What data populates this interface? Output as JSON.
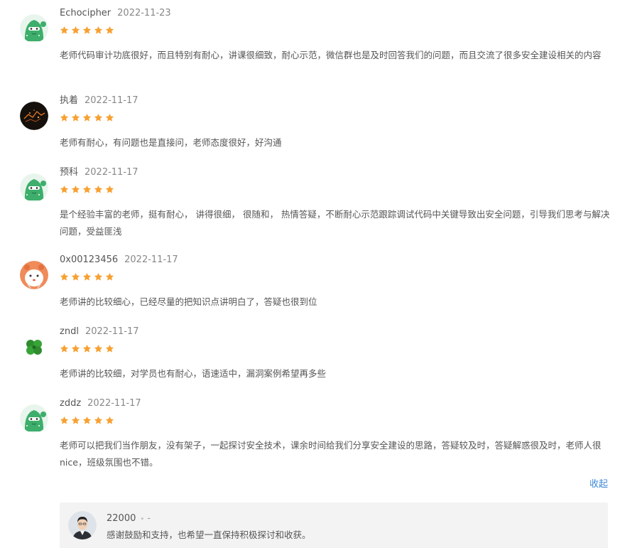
{
  "reviews": [
    {
      "user": "Echocipher",
      "date": "2022-11-23",
      "avatar": "cactus-avatar",
      "stars": 5,
      "text": "老师代码审计功底很好，而且特别有耐心，讲课很细致，耐心示范，微信群也是及时回答我们的问题，而且交流了很多安全建设相关的内容"
    },
    {
      "user": "执着",
      "date": "2022-11-17",
      "avatar": "night-city-avatar",
      "stars": 5,
      "text": "老师有耐心，有问题也是直接问，老师态度很好，好沟通"
    },
    {
      "user": "预科",
      "date": "2022-11-17",
      "avatar": "cactus-avatar",
      "stars": 5,
      "text": "是个经验丰富的老师，挺有耐心， 讲得很细， 很随和， 热情答疑，不断耐心示范跟踪调试代码中关键导致出安全问题，引导我们思考与解决问题，受益匪浅"
    },
    {
      "user": "0x00123456",
      "date": "2022-11-17",
      "avatar": "cartoon-girl-avatar",
      "stars": 5,
      "text": "老师讲的比较细心，已经尽量的把知识点讲明白了，答疑也很到位"
    },
    {
      "user": "zndl",
      "date": "2022-11-17",
      "avatar": "clover-avatar",
      "stars": 5,
      "text": "老师讲的比较细，对学员也有耐心，语速适中，漏洞案例希望再多些"
    },
    {
      "user": "zddz",
      "date": "2022-11-17",
      "avatar": "cactus-avatar",
      "stars": 5,
      "text": "老师可以把我们当作朋友，没有架子，一起探讨安全技术，课余时间给我们分享安全建设的思路，答疑较及时，答疑解惑很及时，老师人很nice，班级氛围也不错。"
    }
  ],
  "collapse_label": "收起",
  "reply": {
    "user": "22000",
    "dot": "•",
    "dash": "-",
    "avatar": "man-portrait-avatar",
    "text": "感谢鼓励和支持，也希望一直保持积极探讨和收获。"
  },
  "colors": {
    "star": "#f7a132",
    "link": "#3d89d8",
    "reply_bg": "#f3f3f3"
  }
}
